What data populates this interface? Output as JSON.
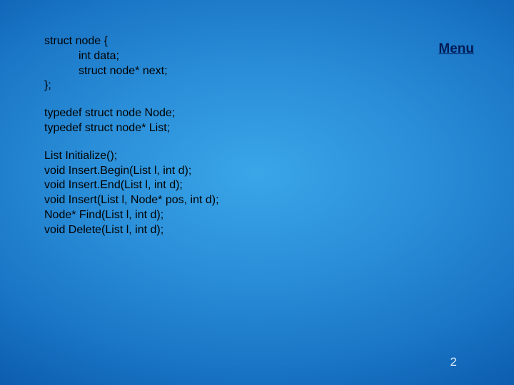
{
  "menu_label": "Menu",
  "page_number": "2",
  "code": {
    "struct": {
      "l1": "struct node {",
      "l2": "int data;",
      "l3": "struct node* next;",
      "l4": "};"
    },
    "typedefs": {
      "l1": "typedef struct node Node;",
      "l2": "typedef struct node* List;"
    },
    "funcs": {
      "l1": "List  Initialize();",
      "l2": "void Insert.Begin(List l, int d);",
      "l3": "void Insert.End(List l, int d);",
      "l4": "void Insert(List l, Node* pos, int d);",
      "l5": "Node* Find(List l, int d);",
      "l6": "void Delete(List l, int d);"
    }
  }
}
